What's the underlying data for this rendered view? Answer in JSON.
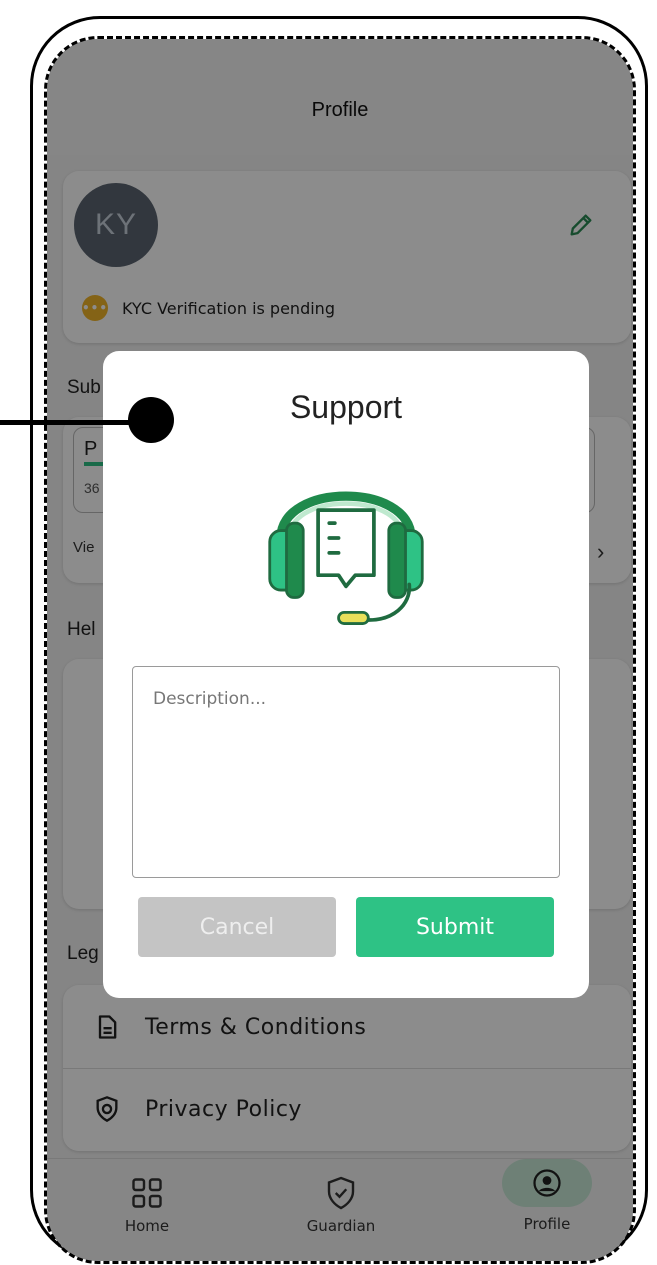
{
  "header": {
    "title": "Profile"
  },
  "profile": {
    "avatar_initials": "KY",
    "kyc_status": "KYC Verification is pending",
    "edit_icon": "pencil-icon"
  },
  "sections": {
    "subscription_partial": "Sub",
    "plan_partial": "P",
    "plan_days_partial": "36",
    "view_partial": "Vie",
    "help_partial": "Hel",
    "legal_partial": "Leg"
  },
  "legal": {
    "items": [
      {
        "label": "Terms & Conditions",
        "icon": "document-icon"
      },
      {
        "label": "Privacy Policy",
        "icon": "shield-lock-icon"
      }
    ]
  },
  "nav": {
    "items": [
      {
        "label": "Home",
        "icon": "grid-icon"
      },
      {
        "label": "Guardian",
        "icon": "shield-check-icon"
      },
      {
        "label": "Profile",
        "icon": "user-circle-icon",
        "active": true
      }
    ]
  },
  "modal": {
    "title": "Support",
    "description_placeholder": "Description...",
    "cancel_label": "Cancel",
    "submit_label": "Submit"
  },
  "colors": {
    "accent": "#2ec285",
    "kyc_badge": "#f0b429",
    "avatar_bg": "#5b6571"
  }
}
